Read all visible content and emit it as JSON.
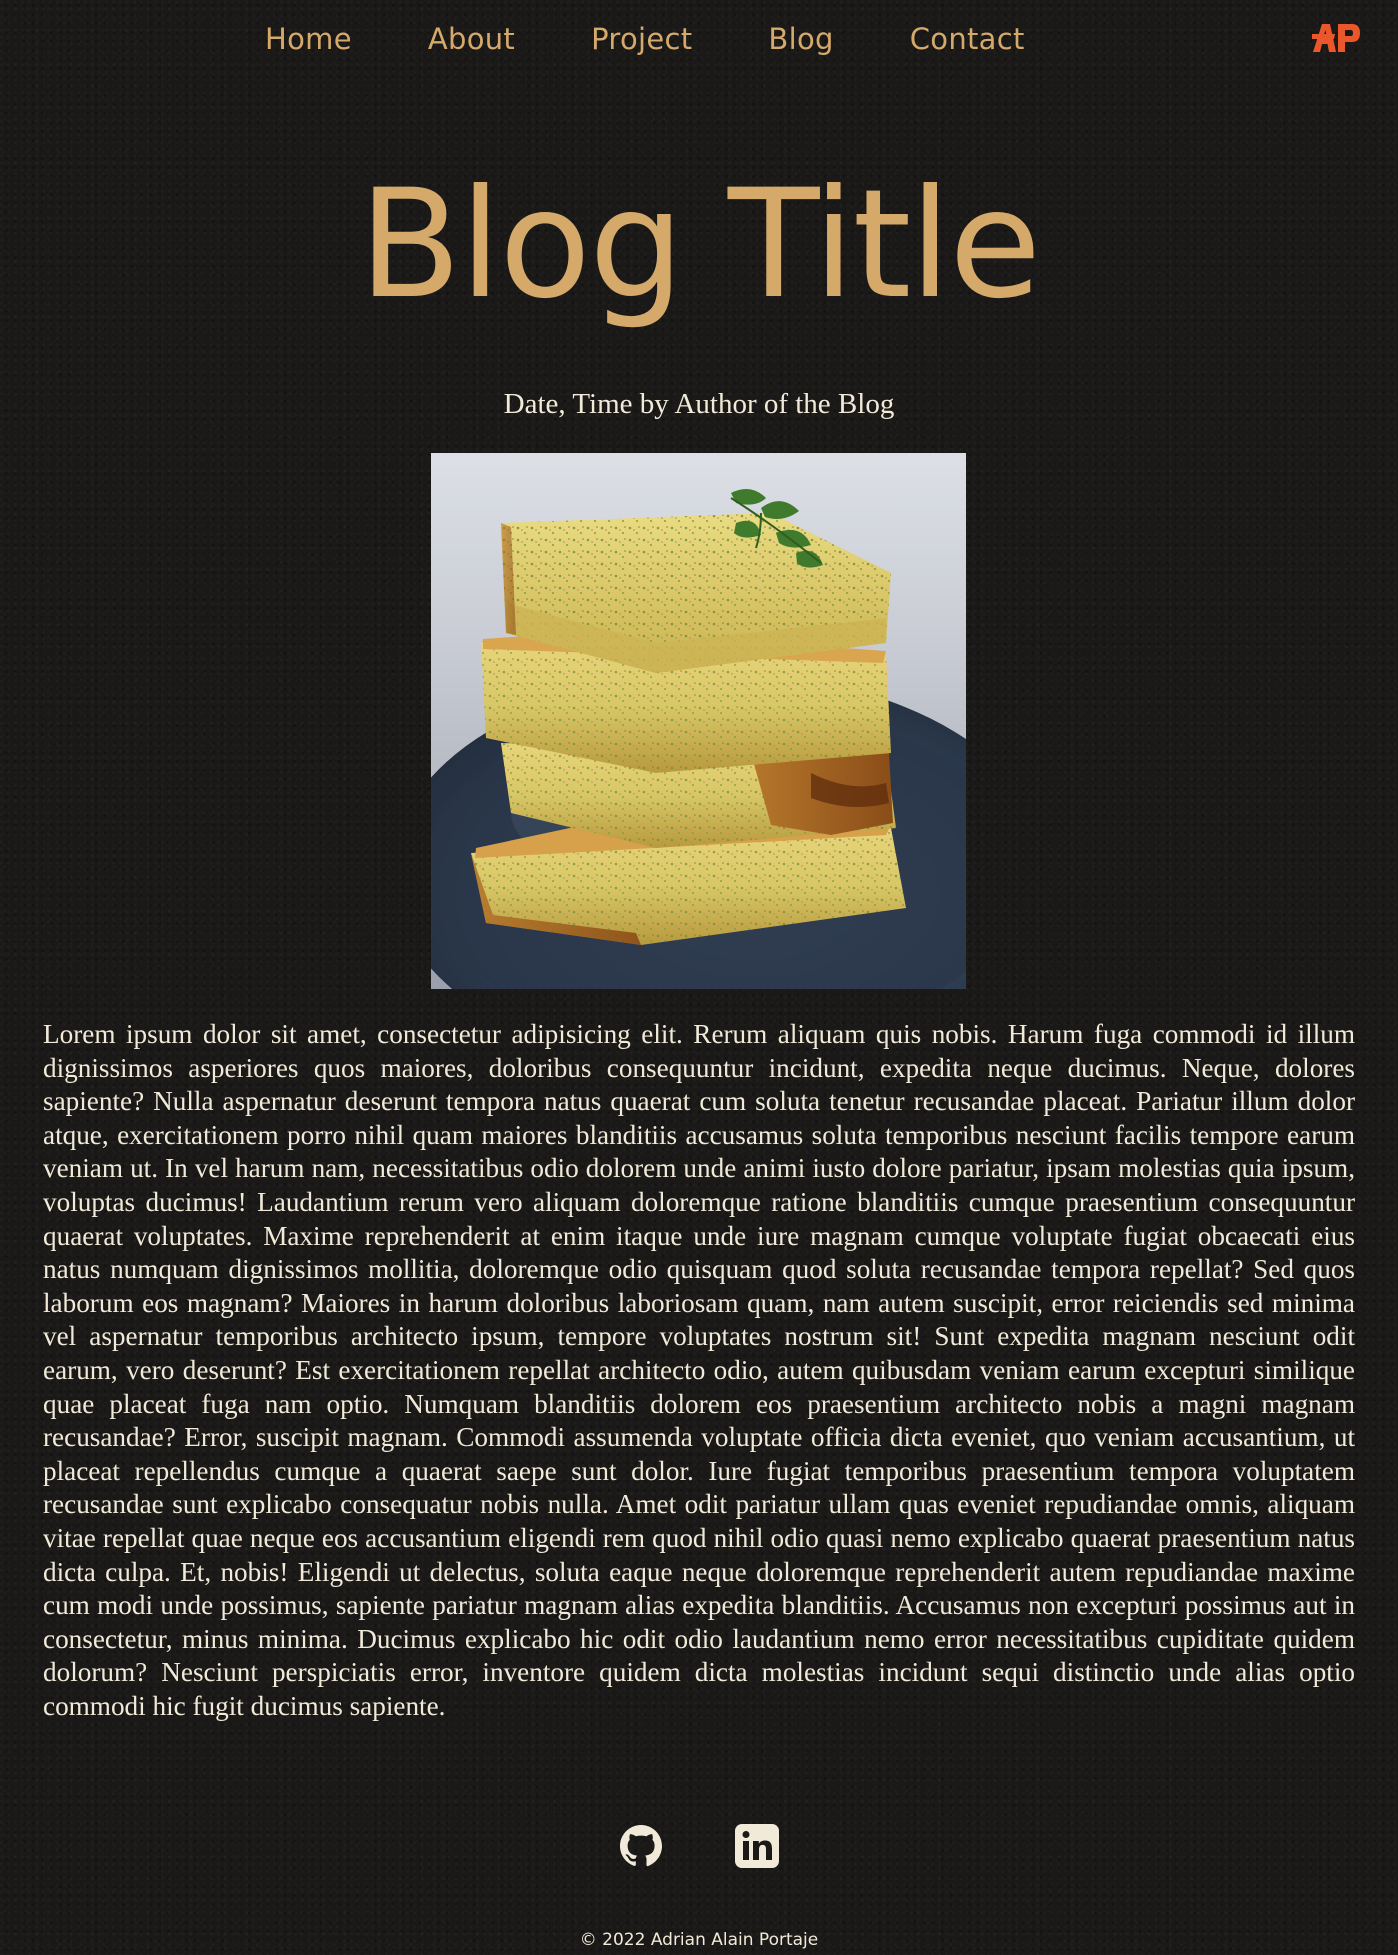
{
  "nav": {
    "items": [
      {
        "label": "Home"
      },
      {
        "label": "About"
      },
      {
        "label": "Project"
      },
      {
        "label": "Blog"
      },
      {
        "label": "Contact"
      }
    ],
    "logo": {
      "text": "AP",
      "color": "#e9572b",
      "icon": "ap-logo"
    }
  },
  "post": {
    "title": "Blog Title",
    "byline": "Date, Time by Author of the Blog",
    "image": {
      "icon": "frittata-photo"
    },
    "body": "Lorem ipsum dolor sit amet, consectetur adipisicing elit. Rerum aliquam quis nobis. Harum fuga commodi id illum dignissimos asperiores quos maiores, doloribus consequuntur incidunt, expedita neque ducimus. Neque, dolores sapiente? Nulla aspernatur deserunt tempora natus quaerat cum soluta tenetur recusandae placeat. Pariatur illum dolor atque, exercitationem porro nihil quam maiores blanditiis accusamus soluta temporibus nesciunt facilis tempore earum veniam ut. In vel harum nam, necessitatibus odio dolorem unde animi iusto dolore pariatur, ipsam molestias quia ipsum, voluptas ducimus! Laudantium rerum vero aliquam doloremque ratione blanditiis cumque praesentium consequuntur quaerat voluptates. Maxime reprehenderit at enim itaque unde iure magnam cumque voluptate fugiat obcaecati eius natus numquam dignissimos mollitia, doloremque odio quisquam quod soluta recusandae tempora repellat? Sed quos laborum eos magnam? Maiores in harum doloribus laboriosam quam, nam autem suscipit, error reiciendis sed minima vel aspernatur temporibus architecto ipsum, tempore voluptates nostrum sit! Sunt expedita magnam nesciunt odit earum, vero deserunt? Est exercitationem repellat architecto odio, autem quibusdam veniam earum excepturi similique quae placeat fuga nam optio. Numquam blanditiis dolorem eos praesentium architecto nobis a magni magnam recusandae? Error, suscipit magnam. Commodi assumenda voluptate officia dicta eveniet, quo veniam accusantium, ut placeat repellendus cumque a quaerat saepe sunt dolor. Iure fugiat temporibus praesentium tempora voluptatem recusandae sunt explicabo consequatur nobis nulla. Amet odit pariatur ullam quas eveniet repudiandae omnis, aliquam vitae repellat quae neque eos accusantium eligendi rem quod nihil odio quasi nemo explicabo quaerat praesentium natus dicta culpa. Et, nobis! Eligendi ut delectus, soluta eaque neque doloremque reprehenderit autem repudiandae maxime cum modi unde possimus, sapiente pariatur magnam alias expedita blanditiis. Accusamus non excepturi possimus aut in consectetur, minus minima. Ducimus explicabo hic odit odio laudantium nemo error necessitatibus cupiditate quidem dolorum? Nesciunt perspiciatis error, inventore quidem dicta molestias incidunt sequi distinctio unde alias optio commodi hic fugit ducimus sapiente."
  },
  "socials": [
    {
      "icon": "github-icon"
    },
    {
      "icon": "linkedin-icon"
    }
  ],
  "footer": {
    "copyright": "© 2022 Adrian Alain Portaje"
  },
  "colors": {
    "accent": "#d4a96a",
    "text": "#f2ead8",
    "background": "#1a1918",
    "logo": "#e9572b"
  }
}
